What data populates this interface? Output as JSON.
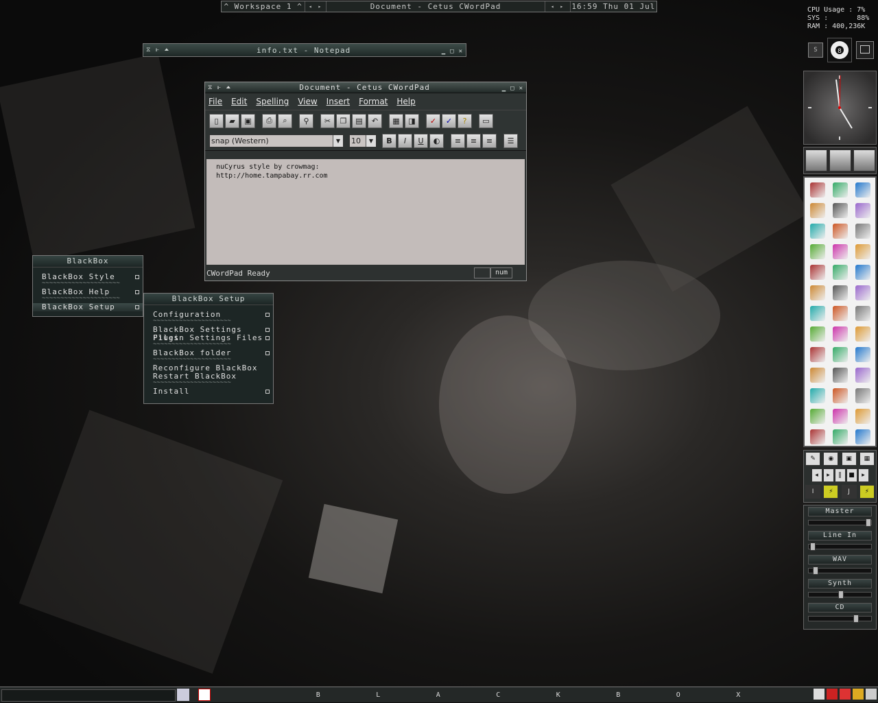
{
  "toolbar": {
    "workspace": "^ Workspace 1 ^",
    "window_title": "Document - Cetus CWordPad",
    "clock": "16:59 Thu 01 Jul"
  },
  "sysmon": {
    "cpu": "CPU Usage : 7%",
    "sys": "SYS :       88%",
    "ram": "RAM : 400,236K"
  },
  "notepad": {
    "title": "info.txt - Notepad"
  },
  "wordpad": {
    "title": "Document - Cetus CWordPad",
    "menu": [
      "File",
      "Edit",
      "Spelling",
      "View",
      "Insert",
      "Format",
      "Help"
    ],
    "font": "snap (Western)",
    "size": "10",
    "doc_lines": [
      "nuCyrus style by crowmag:",
      "http://home.tampabay.rr.com"
    ],
    "status": "CWordPad Ready",
    "num": "num"
  },
  "bbmenu": {
    "title": "BlackBox",
    "items": [
      "BlackBox Style",
      "BlackBox Help",
      "BlackBox Setup"
    ],
    "sep": "~~~~~~~~~~~~~~~~~~~~~"
  },
  "setup_menu": {
    "title": "BlackBox Setup",
    "items": [
      "Configuration",
      "BlackBox Settings Files",
      "Plugin Settings Files",
      "BlackBox folder",
      "Reconfigure BlackBox",
      "Restart BlackBox",
      "Install"
    ],
    "sep": "~~~~~~~~~~~~~~~~~~~~~"
  },
  "mixer": {
    "channels": [
      {
        "label": "Master",
        "level": 0.95
      },
      {
        "label": "Line In",
        "level": 0.05
      },
      {
        "label": "WAV",
        "level": 0.1
      },
      {
        "label": "Synth",
        "level": 0.5
      },
      {
        "label": "CD",
        "level": 0.75
      }
    ]
  },
  "bottombar": {
    "letters": [
      "B",
      "L",
      "A",
      "C",
      "K",
      "B",
      "O",
      "X"
    ]
  },
  "slit": {
    "s_button": "S"
  },
  "launcher_icons": [
    "spider-icon",
    "browser-icon",
    "ftp-icon",
    "network-icon",
    "lightbulb-icon",
    "link-icon",
    "notepad-icon",
    "editor-icon",
    "pen-icon",
    "windows-icon",
    "drive-icon",
    "cookie-icon",
    "paint-icon",
    "gimp-icon",
    "package-icon",
    "tools-icon",
    "compiler-icon",
    "flask-icon",
    "pt-icon",
    "font-icon",
    "disc-icon",
    "box-icon",
    "hammer-icon",
    "drum-icon",
    "wave-icon",
    "keyboard-icon",
    "magnet-icon",
    "image-icon",
    "error-icon",
    "bars-icon",
    "parrot-icon",
    "pro-icon",
    "joystick-icon",
    "equalizer-icon",
    "meter-icon",
    "antenna-icon",
    "pause-icon",
    "cd-tool-icon",
    "window-icon"
  ]
}
